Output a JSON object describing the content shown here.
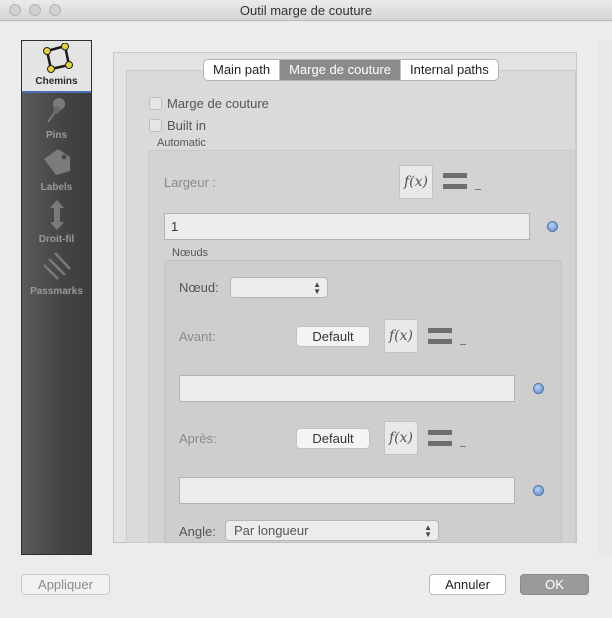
{
  "window": {
    "title": "Outil marge de couture"
  },
  "sidebar": {
    "items": [
      {
        "label": "Chemins",
        "icon": "path-polygon-icon",
        "active": true
      },
      {
        "label": "Pins",
        "icon": "pin-icon"
      },
      {
        "label": "Labels",
        "icon": "label-tag-icon"
      },
      {
        "label": "Droit-fil",
        "icon": "grainline-arrow-icon"
      },
      {
        "label": "Passmarks",
        "icon": "passmarks-icon"
      }
    ]
  },
  "tabs": [
    {
      "label": "Main path"
    },
    {
      "label": "Marge de couture",
      "selected": true
    },
    {
      "label": "Internal paths"
    }
  ],
  "options": {
    "seam_allowance_label": "Marge de couture",
    "built_in_label": "Built in"
  },
  "automatic": {
    "title": "Automatic",
    "width_label": "Largeur :",
    "fx_label": "f(x)",
    "width_value": "1"
  },
  "nodes": {
    "title": "Nœuds",
    "node_label": "Nœud:",
    "node_value": "",
    "before_label": "Avant:",
    "before_default": "Default",
    "before_value": "",
    "after_label": "Après:",
    "after_default": "Default",
    "after_value": "",
    "angle_label": "Angle:",
    "angle_value": "Par longueur"
  },
  "buttons": {
    "apply": "Appliquer",
    "cancel": "Annuler",
    "ok": "OK"
  },
  "colors": {
    "sidebar_bg": "#444444",
    "tab_selected": "#8b8b8b",
    "active_accent": "#4a6fb5"
  }
}
